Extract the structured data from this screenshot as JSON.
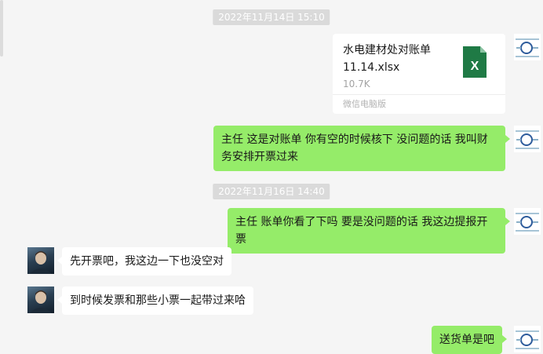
{
  "chat": {
    "timestamps": [
      "2022年11月14日 15:10",
      "2022年11月16日 14:40"
    ],
    "file": {
      "name": "水电建材处对账单11.14.xlsx",
      "size": "10.7K",
      "source": "微信电脑版",
      "icon": "excel-file-icon",
      "icon_letter": "X",
      "icon_color": "#1f7a45"
    },
    "messages": [
      {
        "sender": "self",
        "text": "主任 这是对账单 你有空的时候核下 没问题的话 我叫财务安排开票过来"
      },
      {
        "sender": "self",
        "text": "主任 账单你看了下吗 要是没问题的话 我这边提报开票"
      },
      {
        "sender": "other",
        "text": "先开票吧，我这边一下也没空对"
      },
      {
        "sender": "other",
        "text": "到时候发票和那些小票一起带过来哈"
      },
      {
        "sender": "self",
        "text": "送货单是吧"
      }
    ]
  },
  "colors": {
    "background": "#f5f5f5",
    "self_bubble": "#95ec69",
    "other_bubble": "#ffffff",
    "timestamp_bg": "#dadada"
  }
}
